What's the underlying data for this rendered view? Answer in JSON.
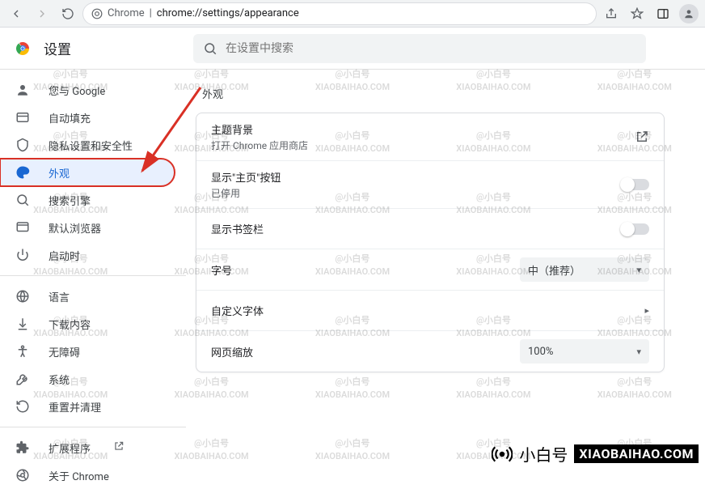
{
  "toolbar": {
    "url_scheme": "Chrome",
    "url_path": "chrome://settings/appearance"
  },
  "header": {
    "title": "设置",
    "search_placeholder": "在设置中搜索"
  },
  "sidebar": {
    "items": [
      {
        "icon": "person",
        "label": "您与 Google"
      },
      {
        "icon": "autofill",
        "label": "自动填充"
      },
      {
        "icon": "shield",
        "label": "隐私设置和安全性"
      },
      {
        "icon": "palette",
        "label": "外观",
        "active": true
      },
      {
        "icon": "search",
        "label": "搜索引擎"
      },
      {
        "icon": "browser",
        "label": "默认浏览器"
      },
      {
        "icon": "power",
        "label": "启动时"
      }
    ],
    "items2": [
      {
        "icon": "globe",
        "label": "语言"
      },
      {
        "icon": "download",
        "label": "下载内容"
      },
      {
        "icon": "access",
        "label": "无障碍"
      },
      {
        "icon": "wrench",
        "label": "系统"
      },
      {
        "icon": "reset",
        "label": "重置并清理"
      }
    ],
    "items3": [
      {
        "icon": "extension",
        "label": "扩展程序",
        "ext": true
      },
      {
        "icon": "chrome",
        "label": "关于 Chrome"
      }
    ]
  },
  "section": {
    "title": "外观",
    "rows": {
      "theme": {
        "primary": "主题背景",
        "secondary": "打开 Chrome 应用商店"
      },
      "home_button": {
        "primary": "显示\"主页\"按钮",
        "secondary": "已停用"
      },
      "bookmarks": {
        "primary": "显示书签栏"
      },
      "font_size": {
        "primary": "字号",
        "value": "中（推荐）"
      },
      "custom_fonts": {
        "primary": "自定义字体"
      },
      "page_zoom": {
        "primary": "网页缩放",
        "value": "100%"
      }
    }
  },
  "watermark": {
    "line1": "@小白号",
    "line2": "XIAOBAIHAO.COM",
    "footer_cn": "小白号",
    "footer_en": "XIAOBAIHAO.COM"
  }
}
